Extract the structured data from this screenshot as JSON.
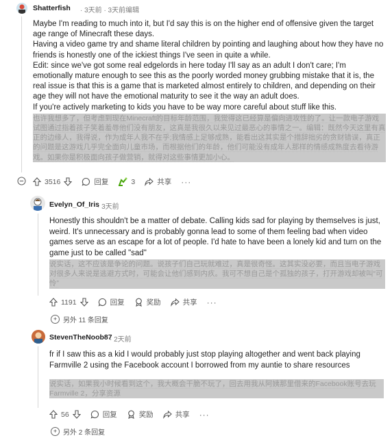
{
  "comments": [
    {
      "username": "Shatterfish",
      "meta": "· 3天前 · 3天前编辑",
      "paragraphs": [
        "Maybe I'm reading to much into it, but I'd say this is on the higher end of offensive given the target age range of Minecraft these days.",
        "Having a video game try and shame literal children by pointing and laughing about how they have no friends is honestly one of the ickiest things I've seen in quite a while.",
        "Edit: since we've got some real edgelords in here today I'll say as an adult I don't care; I'm emotionally mature enough to see this as the poorly worded money grubbing mistake that it is, the real issue is that this is a game that is marketed almost entirely to children, and depending on their age they will not have the emotional maturity to see it the way an adult does.",
        "If you're actively marketing to kids you have to be way more careful about stuff like this."
      ],
      "translation": "也许我想多了，但考虑到现在Minecraft的目标年龄范围，我觉得这已经算是偏向进攻性的了。让一款电子游戏试图通过指着孩子笑着羞辱他们没有朋友，这真是我很久以来见过最恶心的事情之一。编辑：既然今天这里有真正的边缘人，我得说，作为成年人我不在乎;我情感上足够成熟，能看出这其实是个措辞拙劣的贪财错误，真正的问题是这游戏几乎完全面向儿童市场，而根据他们的年龄，他们可能没有成年人那样的情感成熟度去看待游戏。如果你是积极面向孩子做营销，就得对这些事情更加小心。",
      "actions": {
        "upvotes": "3516",
        "reply": "回复",
        "award_count": "3",
        "share": "共享"
      }
    },
    {
      "username": "Evelyn_Of_Iris",
      "meta": "· 3天前",
      "paragraphs": [
        "Honestly this shouldn't be a matter of debate. Calling kids sad for playing by themselves is just, weird. It's unnecessary and is probably gonna lead to some of them feeling bad when video games serve as an escape for a lot of people. I'd hate to have been a lonely kid and turn on the game just to be called \"sad\""
      ],
      "translation": "说实话，这不应该是争论的问题。说孩子们自己玩就难过，真是很奇怪。这其实没必要，而且当电子游戏对很多人来说是逃避方式时，可能会让他们感到内疚。我可不想自己是个孤独的孩子，打开游戏却被叫“可怜”",
      "actions": {
        "upvotes": "1191",
        "reply": "回复",
        "award": "奖励",
        "share": "共享"
      },
      "more_replies": "另外 11 条回复"
    },
    {
      "username": "StevenTheNoob87",
      "meta": "· 2天前",
      "paragraphs": [
        "fr if I saw this as a kid I would probably just stop playing altogether and went back playing Farmville 2 using the Facebook account I borrowed from my auntie to share resources"
      ],
      "translation": "说实话，如果我小时候看到这个，我大概会干脆不玩了，回去用我从阿姨那里借来的Facebook账号去玩Farmville 2，分享资源",
      "actions": {
        "upvotes": "56",
        "reply": "回复",
        "award": "奖励",
        "share": "共享"
      },
      "more_replies": "另外 2 条回复"
    }
  ],
  "colors": {
    "text": "#1a1a1b",
    "meta": "#7c7c7c",
    "translation": "#9a9a9a",
    "award_green": "#46a508"
  },
  "icons": [
    "avatar",
    "collapse-icon",
    "upvote-icon",
    "downvote-icon",
    "comment-icon",
    "award-icon",
    "share-icon",
    "expand-icon"
  ]
}
